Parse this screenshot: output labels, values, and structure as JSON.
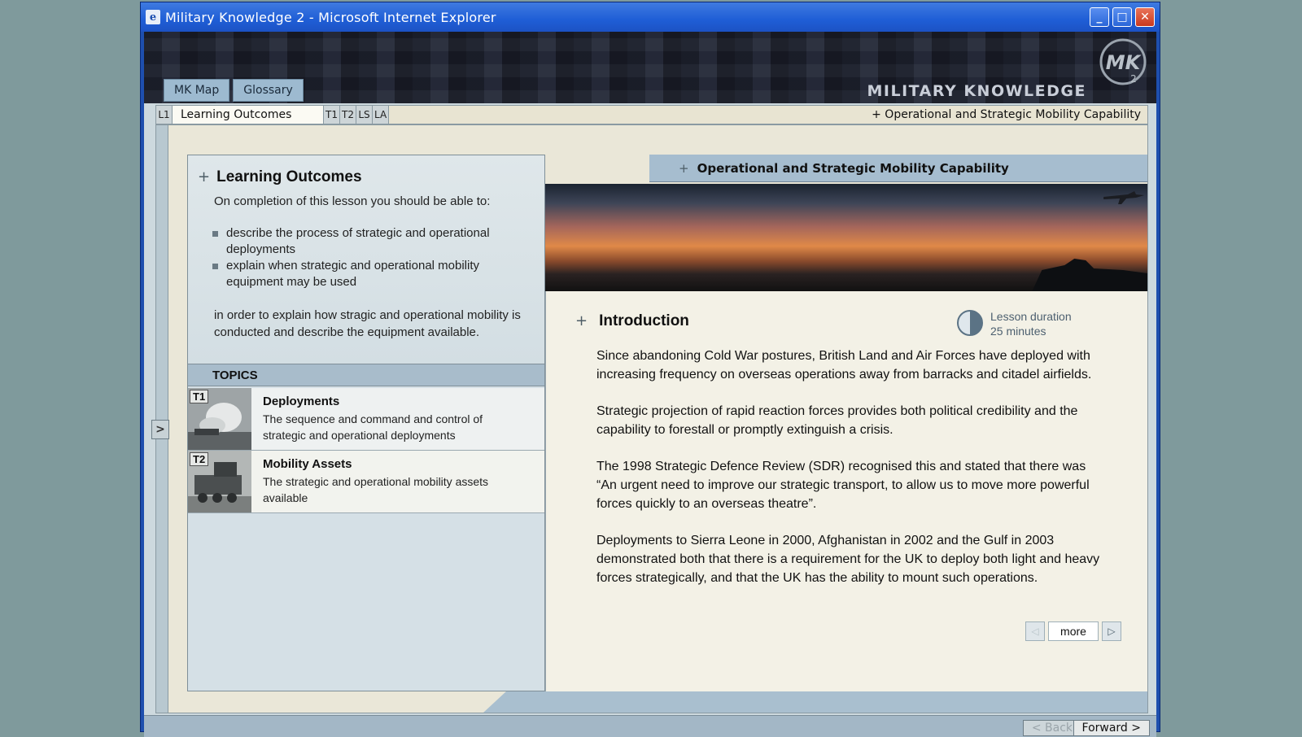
{
  "window": {
    "title": "Military Knowledge 2 - Microsoft Internet Explorer",
    "buttons": {
      "minimize": "_",
      "maximize": "□",
      "close": "✕"
    }
  },
  "banner": {
    "brand": "MILITARY KNOWLEDGE",
    "logo_text": "MK",
    "logo_sub": "2"
  },
  "top_nav": {
    "map": "MK Map",
    "glossary": "Glossary"
  },
  "tabs": {
    "lesson": "L1",
    "active": "Learning Outcomes",
    "topics": [
      "T1",
      "T2",
      "LS",
      "LA"
    ],
    "breadcrumb": "+  Operational and Strategic Mobility Capability"
  },
  "expand": ">",
  "learning_outcomes": {
    "title": "Learning Outcomes",
    "intro": "On completion of this lesson you should be able to:",
    "items": [
      "describe the process of strategic and operational deployments",
      "explain when strategic and operational mobility equipment may be used"
    ],
    "outro": "in order to explain how stragic and operational mobility is conducted and describe the equipment available."
  },
  "topics": {
    "heading": "TOPICS",
    "items": [
      {
        "label": "T1",
        "title": "Deployments",
        "desc": "The sequence and command and control of strategic and operational deployments"
      },
      {
        "label": "T2",
        "title": "Mobility Assets",
        "desc": "The strategic and operational mobility assets available"
      }
    ]
  },
  "main": {
    "header": "Operational and Strategic Mobility Capability",
    "intro_title": "Introduction",
    "duration": {
      "label": "Lesson duration",
      "value": "25 minutes"
    },
    "paragraphs": [
      "Since abandoning Cold War postures, British Land and Air Forces have deployed with increasing frequency on overseas operations away from barracks and citadel airfields.",
      "Strategic projection of rapid reaction forces provides both political credibility and the capability to forestall or promptly extinguish a crisis.",
      "The 1998 Strategic Defence Review (SDR) recognised this and stated that there was “An urgent need to improve our strategic transport, to allow us to move more powerful forces quickly to an overseas theatre”.",
      "Deployments to Sierra Leone in 2000, Afghanistan in 2002 and the Gulf in 2003 demonstrated both that there is a requirement for the UK to deploy both light and heavy forces strategically, and that the UK has the ability to mount such operations."
    ],
    "pager": {
      "prev": "◁",
      "more": "more",
      "next": "▷"
    }
  },
  "footer": {
    "back": "< Back",
    "forward": "Forward >"
  }
}
